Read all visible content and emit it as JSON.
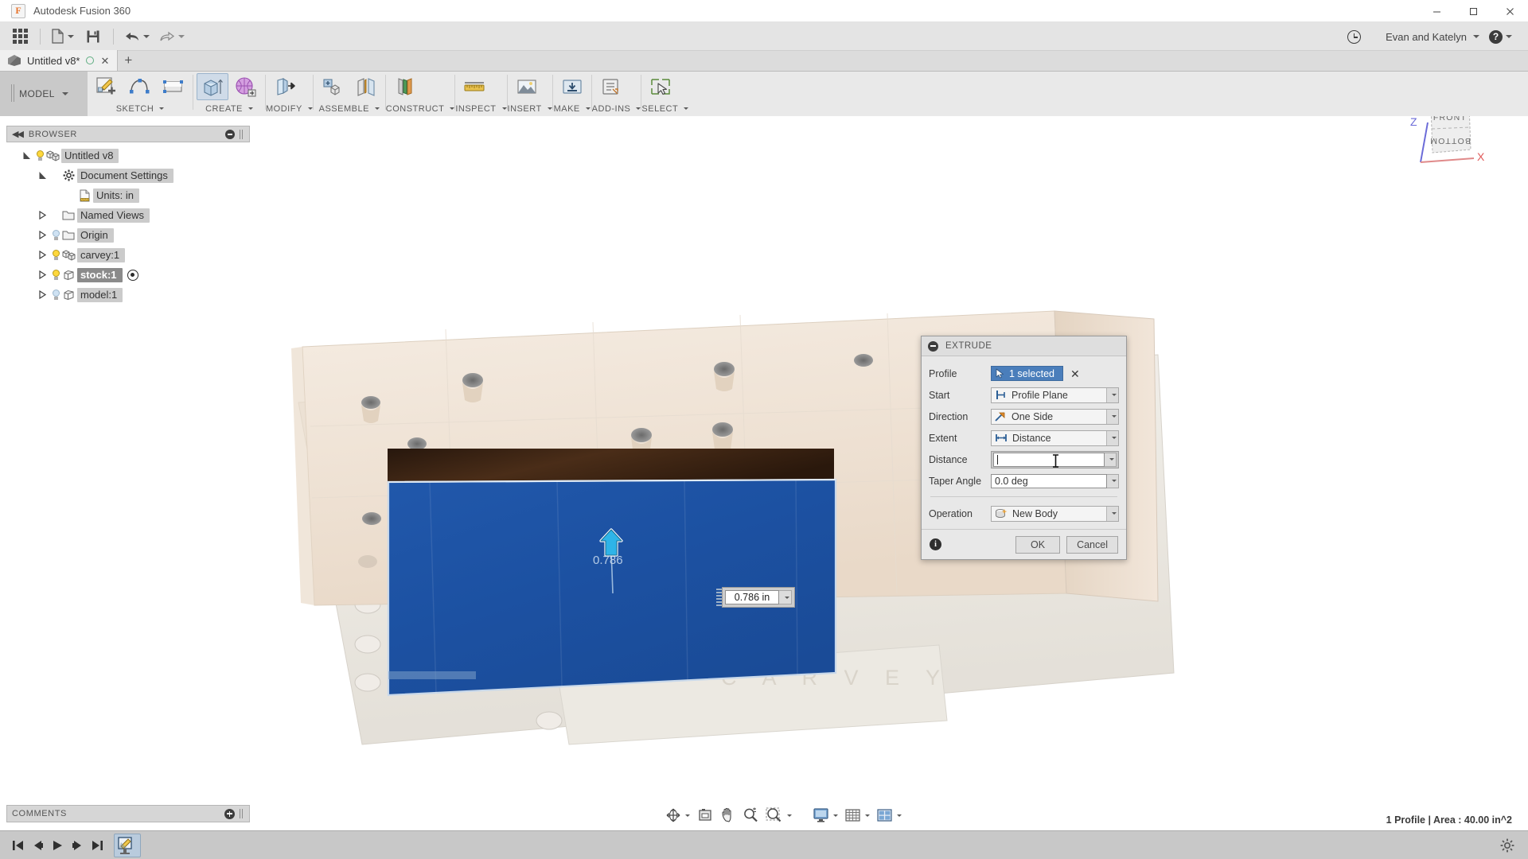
{
  "window": {
    "app_title": "Autodesk Fusion 360",
    "logo_glyph": "F",
    "minimize": "–",
    "maximize": "☐",
    "close": "✕"
  },
  "quick_access": {
    "app_grid_icon": "grid-icon",
    "new_label": "new-document",
    "save_label": "save",
    "undo_label": "undo",
    "redo_label": "redo",
    "recent_icon": "clock-icon",
    "user_name": "Evan and Katelyn",
    "help_glyph": "?"
  },
  "doc_tabs": [
    {
      "title": "Untitled v8*",
      "close_glyph": "✕"
    }
  ],
  "new_tab_glyph": "+",
  "ribbon": {
    "workspace": "MODEL",
    "groups": [
      {
        "label": "SKETCH",
        "icons": [
          "create-sketch-icon",
          "spline-icon",
          "rectangle-icon"
        ]
      },
      {
        "label": "CREATE",
        "icons": [
          "extrude-icon",
          "revolve-icon"
        ]
      },
      {
        "label": "MODIFY",
        "icons": [
          "press-pull-icon"
        ]
      },
      {
        "label": "ASSEMBLE",
        "icons": [
          "new-component-icon",
          "joint-icon"
        ]
      },
      {
        "label": "CONSTRUCT",
        "icons": [
          "offset-plane-icon"
        ]
      },
      {
        "label": "INSPECT",
        "icons": [
          "measure-icon"
        ]
      },
      {
        "label": "INSERT",
        "icons": [
          "insert-mesh-icon"
        ]
      },
      {
        "label": "MAKE",
        "icons": [
          "3d-print-icon"
        ]
      },
      {
        "label": "ADD-INS",
        "icons": [
          "scripts-addins-icon"
        ]
      },
      {
        "label": "SELECT",
        "icons": [
          "select-icon"
        ]
      }
    ]
  },
  "browser": {
    "title": "BROWSER",
    "collapse_glyph": "◀◀",
    "tree": [
      {
        "indent": 0,
        "expander": "open",
        "bulb": "on",
        "icon": "component-icon",
        "label": "Untitled v8",
        "selected": false
      },
      {
        "indent": 1,
        "expander": "open",
        "bulb": "none",
        "icon": "gear-icon",
        "label": "Document Settings",
        "selected": false
      },
      {
        "indent": 2,
        "expander": "none",
        "bulb": "none",
        "icon": "units-icon",
        "label": "Units: in",
        "selected": false
      },
      {
        "indent": 1,
        "expander": "closed",
        "bulb": "none",
        "icon": "folder-icon",
        "label": "Named Views",
        "selected": false
      },
      {
        "indent": 1,
        "expander": "closed",
        "bulb": "off",
        "icon": "folder-icon",
        "label": "Origin",
        "selected": false
      },
      {
        "indent": 1,
        "expander": "closed",
        "bulb": "on",
        "icon": "component-icon",
        "label": "carvey:1",
        "selected": false
      },
      {
        "indent": 1,
        "expander": "closed",
        "bulb": "on",
        "icon": "body-icon",
        "label": "stock:1",
        "selected": true
      },
      {
        "indent": 1,
        "expander": "closed",
        "bulb": "off",
        "icon": "body-icon",
        "label": "model:1",
        "selected": false
      }
    ]
  },
  "viewcube": {
    "front_face": "FRONT",
    "bottom_face": "BOTTOM",
    "axis_z": "Z",
    "axis_x": "X"
  },
  "extrude_dialog": {
    "title": "EXTRUDE",
    "rows": {
      "profile_label": "Profile",
      "profile_value": "1 selected",
      "profile_clear_glyph": "✕",
      "start_label": "Start",
      "start_value": "Profile Plane",
      "direction_label": "Direction",
      "direction_value": "One Side",
      "extent_label": "Extent",
      "extent_value": "Distance",
      "distance_label": "Distance",
      "distance_value": "",
      "taper_label": "Taper Angle",
      "taper_value": "0.0 deg",
      "operation_label": "Operation",
      "operation_value": "New Body"
    },
    "info_glyph": "i",
    "ok_label": "OK",
    "cancel_label": "Cancel"
  },
  "canvas": {
    "manipulator_value": "0.786",
    "dimension_value": "0.786 in",
    "watermark": "CARVEY"
  },
  "comments": {
    "title": "COMMENTS"
  },
  "navbar": {
    "orbit_icon": "orbit-icon",
    "look_at_icon": "look-at-icon",
    "pan_icon": "pan-icon",
    "zoom_icon": "zoom-icon",
    "fit_icon": "fit-icon",
    "display_icon": "display-settings-icon",
    "grid_icon": "grid-snaps-icon",
    "viewports_icon": "viewports-icon"
  },
  "status": {
    "text": "1 Profile | Area : 40.00 in^2"
  },
  "timeline": {
    "go_to_beginning": "go-to-beginning-icon",
    "step_back": "step-back-icon",
    "play": "play-icon",
    "step_forward": "step-forward-icon",
    "go_to_end": "go-to-end-icon",
    "edit_sketch_icon": "edit-sketch-icon",
    "settings_icon": "gear-icon"
  },
  "colors": {
    "accent_blue": "#4a7ebb",
    "selection_blue": "#1c55a5",
    "ribbon_bg": "#e9e9e9",
    "panel_bg": "#d6d6d6",
    "stock_tan": "#f0e2d2",
    "wood_dark": "#3a2418"
  }
}
